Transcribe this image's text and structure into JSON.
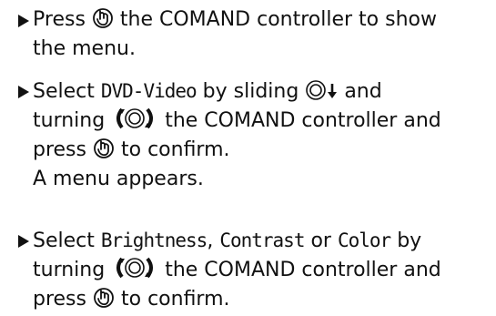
{
  "steps": [
    {
      "lines": [
        {
          "pre": "Press",
          "post": "the COMAND controller to show"
        },
        {
          "text": "the menu."
        }
      ]
    },
    {
      "lines": [
        {
          "pre": "Select",
          "code": "DVD-Video",
          "mid": "by sliding",
          "post": "and"
        },
        {
          "pre": "turning",
          "post": "the COMAND controller and"
        },
        {
          "pre": "press",
          "post": "to confirm."
        },
        {
          "text": "A menu appears."
        }
      ]
    },
    {
      "lines": [
        {
          "pre": "Select",
          "code1": "Brightness",
          "sep1": ",",
          "code2": "Contrast",
          "sep2": "or",
          "code3": "Color",
          "post": "by"
        },
        {
          "pre": "turning",
          "post": "the COMAND controller and"
        },
        {
          "pre": "press",
          "post": "to confirm."
        }
      ]
    }
  ],
  "icons": {
    "press": "controller-press-icon",
    "turn": "controller-turn-icon",
    "slide": "controller-slide-down-icon"
  },
  "colors": {
    "text": "#111111",
    "background": "#ffffff"
  }
}
